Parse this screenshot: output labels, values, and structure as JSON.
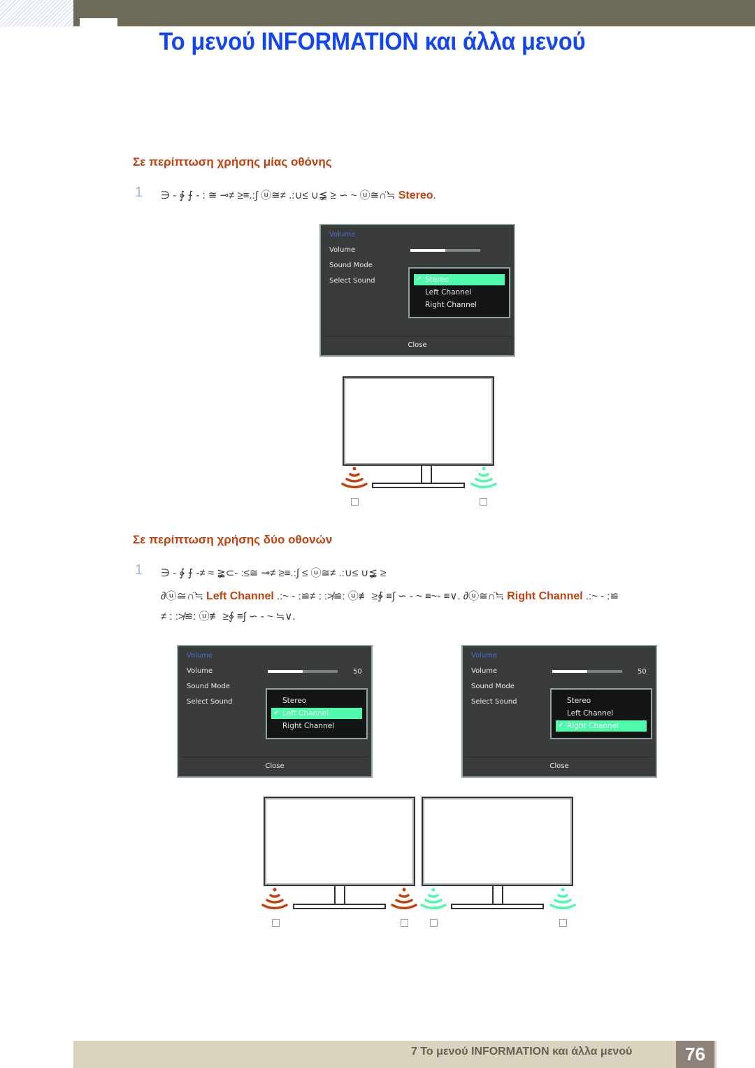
{
  "header": {
    "title": "Το μενού INFORMATION και άλλα μενού"
  },
  "section1": {
    "heading": "Σε περίπτωση χρήσης μίας οθόνης",
    "step_number": "1",
    "step_text_garbled": "∋ -  ∲  ⨍     - : ≅   ⊸≠ ≥≡.:∫    ⓤ≅≠ .:∪≤ ∪≨ ≥ ∽  ~ ⓤ≅∩̈≒",
    "step_highlight": "Stereo",
    "step_end": ".",
    "osd": {
      "title": "Volume",
      "rows": [
        "Volume",
        "Sound Mode",
        "Select Sound"
      ],
      "volume_value": 50,
      "volume_value_label": "",
      "options": [
        "Stereo",
        "Left Channel",
        "Right Channel"
      ],
      "selected": "Stereo",
      "close_label": "Close"
    },
    "speakers": [
      {
        "side": "left",
        "color": "#c2420f"
      },
      {
        "side": "right",
        "color": "#4dfbab"
      }
    ]
  },
  "section2": {
    "heading": "Σε περίπτωση χρήσης δύο οθονών",
    "step_number": "1",
    "step_line1_garbled": "∋ -  ∲  ⨍     -≠  ≈  ≩⊂-  :≤≅   ⊸≠ ≥≡.:∫  ≤  ⓤ≅≠ .:∪≤ ∪≨ ≥",
    "step_line2_prefix": "∂ⓤ≅∩̈≒",
    "step_line2_hl1": "Left Channel",
    "step_line2_mid": ".:~ - :≌≠ : :≯≌: ⓤ≢ ≥∲ ≡∫  ∽ -   ~  ≡~-   ≡∨.  ∂ⓤ≅∩̈≒",
    "step_line2_hl2": "Right Channel",
    "step_line2_end": ".:~ - :≌",
    "step_line3": "≠ : :≯≌: ⓤ≢ ≥∲ ≡∫  ∽ -   ~    ≒∨.",
    "osd_left": {
      "title": "Volume",
      "rows": [
        "Volume",
        "Sound Mode",
        "Select Sound"
      ],
      "volume_value": 50,
      "volume_value_label": "50",
      "options": [
        "Stereo",
        "Left Channel",
        "Right Channel"
      ],
      "selected": "Left Channel",
      "close_label": "Close"
    },
    "osd_right": {
      "title": "Volume",
      "rows": [
        "Volume",
        "Sound Mode",
        "Select Sound"
      ],
      "volume_value": 50,
      "volume_value_label": "50",
      "options": [
        "Stereo",
        "Left Channel",
        "Right Channel"
      ],
      "selected": "Right Channel",
      "close_label": "Close"
    }
  },
  "colors": {
    "title_blue": "#1446ee",
    "heading_orange": "#c2420f",
    "speaker_left": "#c2420f",
    "speaker_right": "#4dfbab",
    "osd_bg": "#3a3c3c",
    "osd_highlight": "#4dfbab"
  },
  "footer": {
    "chapter_text": "7 Το μενού INFORMATION και άλλα μενού",
    "page_number": "76"
  }
}
